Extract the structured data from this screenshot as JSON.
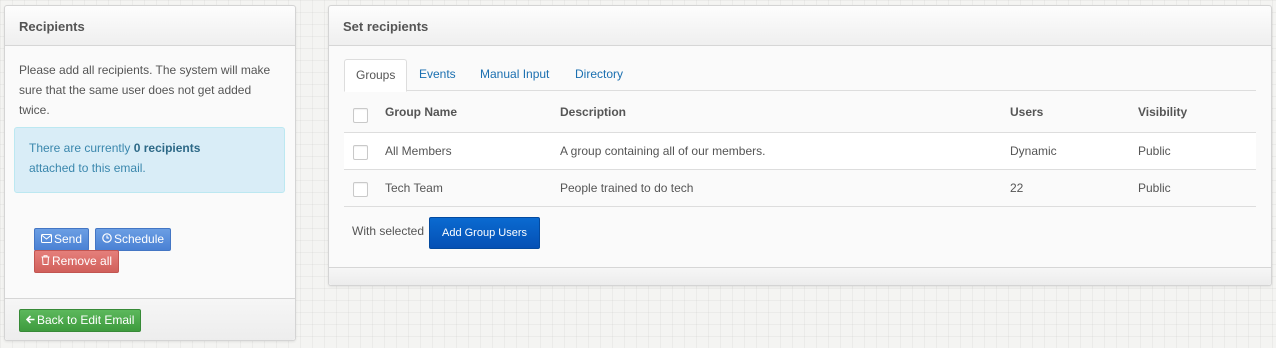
{
  "recipients_panel": {
    "title": "Recipients",
    "instructions": "Please add all recipients. The system will make sure that the same user does not get added twice.",
    "status_prefix": "There are currently ",
    "status_count": "0 recipients",
    "status_suffix": "attached to this email.",
    "send_label": "Send",
    "schedule_label": "Schedule",
    "remove_all_label": "Remove all",
    "back_label": "Back to Edit Email"
  },
  "set_recipients_panel": {
    "title": "Set recipients",
    "tabs": [
      {
        "label": "Groups",
        "active": true
      },
      {
        "label": "Events",
        "active": false
      },
      {
        "label": "Manual Input",
        "active": false
      },
      {
        "label": "Directory",
        "active": false
      }
    ],
    "table": {
      "headers": [
        "Group Name",
        "Description",
        "Users",
        "Visibility"
      ],
      "rows": [
        {
          "name": "All Members",
          "description": "A group containing all of our members.",
          "users": "Dynamic",
          "visibility": "Public"
        },
        {
          "name": "Tech Team",
          "description": "People trained to do tech",
          "users": "22",
          "visibility": "Public"
        }
      ]
    },
    "with_selected_label": "With selected",
    "add_group_users_label": "Add Group Users"
  },
  "icons": {
    "send": "envelope-icon",
    "schedule": "clock-icon",
    "remove_all": "trash-icon",
    "back": "arrow-left-icon"
  },
  "colors": {
    "info_bg": "#d9edf7",
    "info_text": "#3a87ad",
    "link": "#1a6fb0",
    "btn_blue": "#4a81d4",
    "btn_red": "#d1605b",
    "btn_green": "#3e9b3e",
    "btn_primary": "#0550b5"
  }
}
